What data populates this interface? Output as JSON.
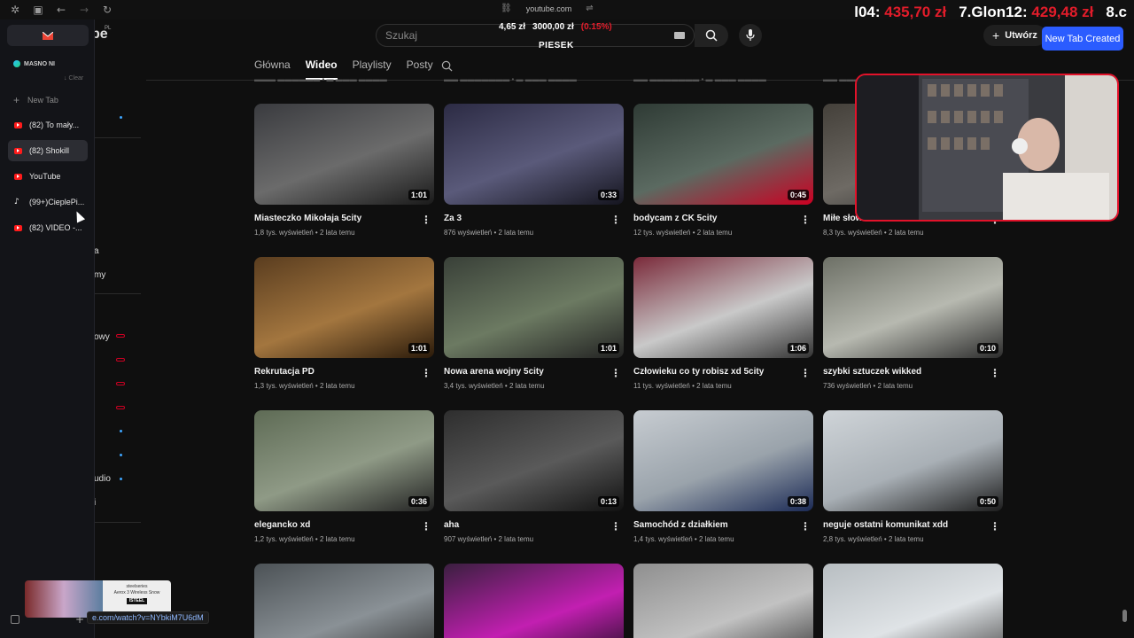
{
  "browser": {
    "url": "youtube.com",
    "status_url": "e.com/watch?v=NYbkiM7U6dM",
    "new_tab_badge": "New Tab Created"
  },
  "overlay": {
    "stats": [
      {
        "label": "l04:",
        "value": "435,70 zł"
      },
      {
        "label": "7.Glon12:",
        "value": "429,48 zł"
      },
      {
        "label": "8.c",
        "value": ""
      }
    ],
    "ticker_price": "4,65 zł",
    "ticker_total": "3000,00 zł",
    "ticker_change": "(0.15%)",
    "ticker_name": "PIESEK"
  },
  "arc_sidebar": {
    "space_name": "MASNO NI",
    "clear_label": "Clear",
    "new_tab_label": "New Tab",
    "tabs": [
      {
        "label": "(82) To mały...",
        "icon": "youtube-icon",
        "active": false
      },
      {
        "label": "(82) Shokill",
        "icon": "youtube-icon",
        "active": true
      },
      {
        "label": "YouTube",
        "icon": "youtube-icon",
        "active": false
      },
      {
        "label": "(99+)CieplePi...",
        "icon": "tiktok-icon",
        "active": false
      },
      {
        "label": "(82) VIDEO -...",
        "icon": "youtube-icon",
        "active": false
      }
    ]
  },
  "yt_header": {
    "logo_tail": "be",
    "logo_region": "PL",
    "search_placeholder": "Szukaj",
    "create_label": "Utwórz"
  },
  "channel_tabs": [
    "Główna",
    "Wideo",
    "Playlisty",
    "Posty"
  ],
  "yt_side_partial": {
    "a": "a",
    "my": "my",
    "owy": "owy",
    "udio": "udio",
    "i": "i"
  },
  "videos": [
    {
      "title": "Miasteczko Mikołaja 5city",
      "meta": "1,8 tys. wyświetleń • 2 lata temu",
      "duration": "1:01"
    },
    {
      "title": "Za 3",
      "meta": "876 wyświetleń • 2 lata temu",
      "duration": "0:33"
    },
    {
      "title": "bodycam z CK 5city",
      "meta": "12 tys. wyświetleń • 2 lata temu",
      "duration": "0:45"
    },
    {
      "title": "Miłe słowa",
      "meta": "8,3 tys. wyświetleń • 2 lata temu",
      "duration": ""
    },
    {
      "title": "Rekrutacja PD",
      "meta": "1,3 tys. wyświetleń • 2 lata temu",
      "duration": "1:01"
    },
    {
      "title": "Nowa arena wojny 5city",
      "meta": "3,4 tys. wyświetleń • 2 lata temu",
      "duration": "1:01"
    },
    {
      "title": "Człowieku co ty robisz xd 5city",
      "meta": "11 tys. wyświetleń • 2 lata temu",
      "duration": "1:06"
    },
    {
      "title": "szybki sztuczek wikked",
      "meta": "736 wyświetleń • 2 lata temu",
      "duration": "0:10"
    },
    {
      "title": "elegancko xd",
      "meta": "1,2 tys. wyświetleń • 2 lata temu",
      "duration": "0:36"
    },
    {
      "title": "aha",
      "meta": "907 wyświetleń • 2 lata temu",
      "duration": "0:13"
    },
    {
      "title": "Samochód z działkiem",
      "meta": "1,4 tys. wyświetleń • 2 lata temu",
      "duration": "0:38"
    },
    {
      "title": "neguje ostatni komunikat xdd",
      "meta": "2,8 tys. wyświetleń • 2 lata temu",
      "duration": "0:50"
    },
    {
      "title": "",
      "meta": "",
      "duration": ""
    },
    {
      "title": "",
      "meta": "",
      "duration": ""
    },
    {
      "title": "",
      "meta": "",
      "duration": ""
    },
    {
      "title": "",
      "meta": "",
      "duration": ""
    }
  ],
  "promo": {
    "brand_line": "steelseries",
    "product": "Aerox 3 Wireless Snow",
    "shop": "ISTEEL"
  },
  "colors": {
    "accent_red": "#e11c2a",
    "badge_blue": "#2b5cff",
    "youtube_red": "#ff0000"
  }
}
